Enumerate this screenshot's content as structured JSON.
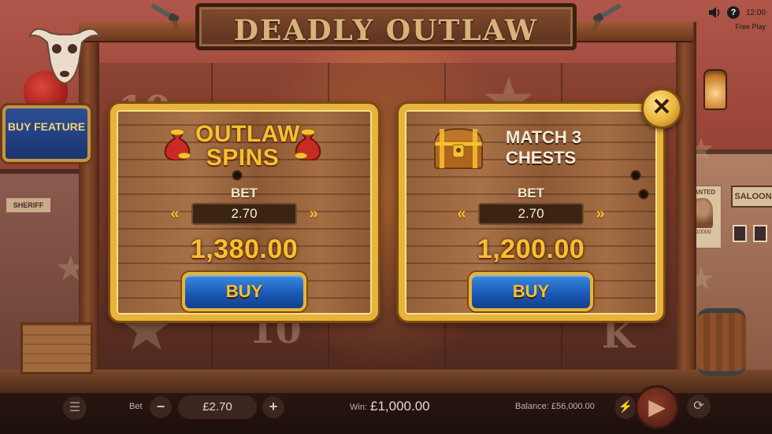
{
  "game": {
    "title": "DEADLY OUTLAW",
    "clock": "12:00",
    "mode": "Free Play",
    "help_glyph": "?",
    "buy_feature_label": "BUY FEATURE"
  },
  "background": {
    "sheriff_sign": "SHERIFF",
    "saloon_sign": "SALOON",
    "wanted_title": "WANTED",
    "wanted_reward": "$10000"
  },
  "buy_modal": {
    "options": [
      {
        "title": "OUTLAW SPINS",
        "bet_label": "BET",
        "bet_value": "2.70",
        "price": "1,380.00",
        "buy_label": "BUY",
        "icon": "money-bag-icon"
      },
      {
        "title": "MATCH 3 CHESTS",
        "bet_label": "BET",
        "bet_value": "2.70",
        "price": "1,200.00",
        "buy_label": "BUY",
        "icon": "treasure-chest-icon"
      }
    ],
    "decrease_glyph": "«",
    "increase_glyph": "»",
    "close_glyph": "✕"
  },
  "bottom_bar": {
    "bet_label": "Bet",
    "bet_value": "£2.70",
    "minus": "−",
    "plus": "+",
    "win_label": "Win:",
    "win_value": "£1,000.00",
    "balance_text": "Balance: £56,000.00"
  },
  "colors": {
    "gold": "#f7c02e",
    "panel_border": "#e8b33a",
    "buy_button_blue": "#1a5ab8",
    "buy_feature_blue": "#2c4f95"
  }
}
